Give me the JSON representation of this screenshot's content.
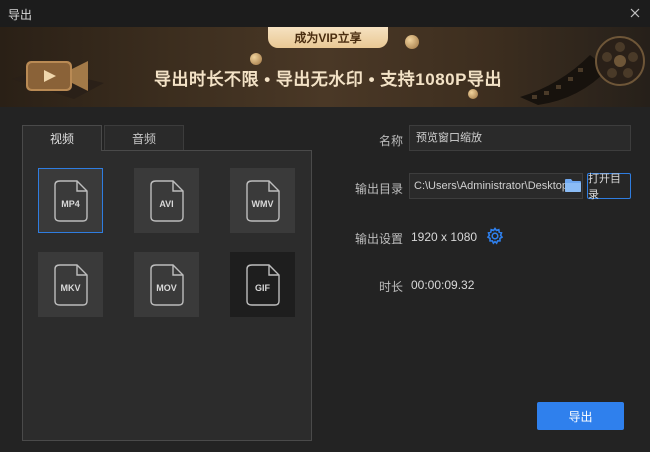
{
  "window": {
    "title": "导出",
    "close_icon": "close-icon"
  },
  "banner": {
    "vip_label": "成为VIP立享",
    "slogan": "导出时长不限 • 导出无水印 • 支持1080P导出",
    "accent_color": "#e9c894"
  },
  "tabs": [
    {
      "label": "视频",
      "active": true
    },
    {
      "label": "音频",
      "active": false
    }
  ],
  "formats": [
    {
      "label": "MP4",
      "selected": true
    },
    {
      "label": "AVI",
      "selected": false
    },
    {
      "label": "WMV",
      "selected": false
    },
    {
      "label": "MKV",
      "selected": false
    },
    {
      "label": "MOV",
      "selected": false
    },
    {
      "label": "GIF",
      "selected": false
    }
  ],
  "form": {
    "name_label": "名称",
    "name_value": "预览窗口缩放",
    "output_dir_label": "输出目录",
    "output_dir_value": "C:\\Users\\Administrator\\Desktop\\",
    "open_dir_label": "打开目录",
    "output_settings_label": "输出设置",
    "resolution": "1920 x 1080",
    "duration_label": "时长",
    "duration_value": "00:00:09.32"
  },
  "actions": {
    "export_label": "导出"
  },
  "colors": {
    "accent": "#2f80ed",
    "background": "#232323"
  }
}
